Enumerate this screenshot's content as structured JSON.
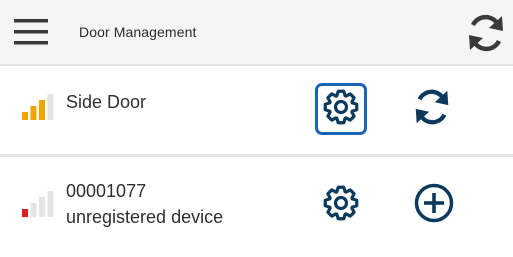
{
  "header": {
    "title": "Door Management",
    "menu_icon": "hamburger-menu-icon",
    "sync_icon": "sync-icon"
  },
  "devices": [
    {
      "name": "Side Door",
      "signal_level": 3,
      "signal_max": 4,
      "signal_color": "#f2a400",
      "settings_icon": "gear-icon",
      "action_icon": "sync-icon",
      "settings_selected": true
    },
    {
      "id": "00001077",
      "status": "unregistered device",
      "signal_level": 1,
      "signal_max": 4,
      "signal_color": "#d81e1e",
      "settings_icon": "gear-icon",
      "action_icon": "add-circle-icon",
      "settings_selected": false
    }
  ],
  "colors": {
    "accent": "#0c3a5c",
    "focus_border": "#1d63b4",
    "signal_inactive": "#e4e4e4",
    "header_background": "#f5f5f5"
  }
}
